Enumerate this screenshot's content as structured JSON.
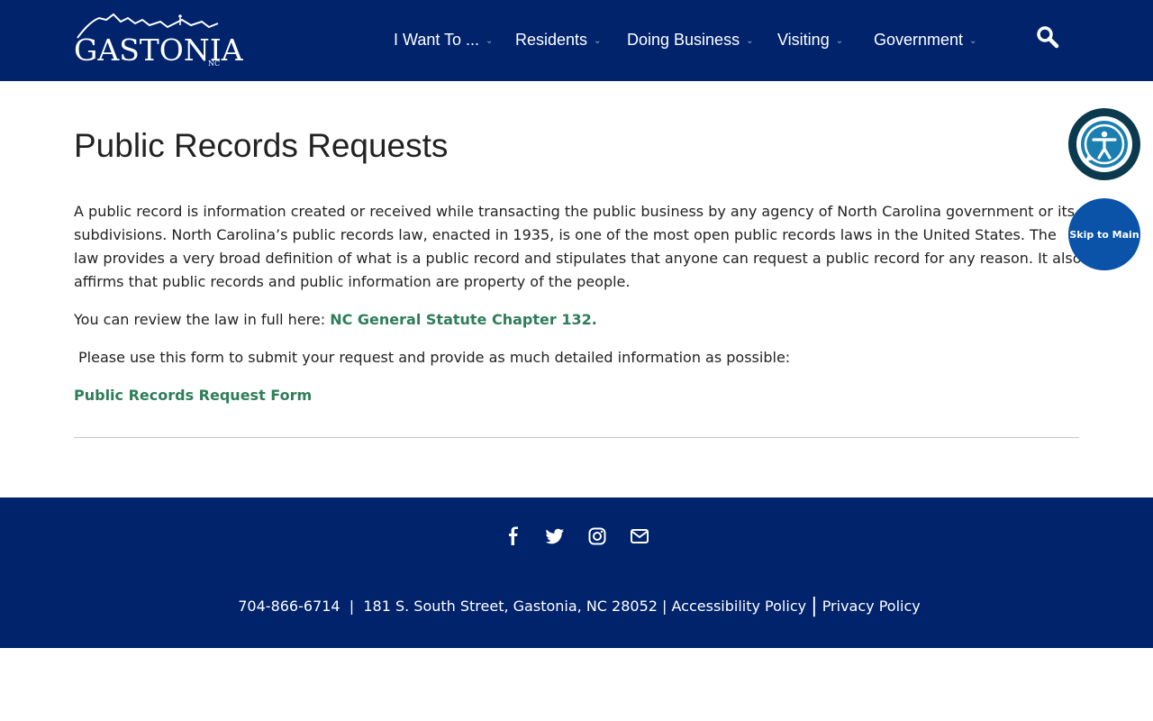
{
  "header": {
    "logo_text": "GASTONIA",
    "logo_sub": "NC",
    "nav": [
      {
        "label": "I Want To ..."
      },
      {
        "label": "Residents"
      },
      {
        "label": "Doing Business"
      },
      {
        "label": "Visiting"
      },
      {
        "label": "Government"
      }
    ],
    "search_icon": "search-icon"
  },
  "main": {
    "title": "Public Records Requests",
    "intro": "A public record is information created or received while transacting the public business by any agency of North Carolina government or its subdivisions.  North Carolina’s public records law, enacted in 1935, is one of the most open public records laws in the United States. The law provides a very broad definition of what is a public record and stipulates that anyone can request a public record for any reason. It also affirms that public records and public information are property of the people.",
    "law_prefix": "You can review the law in full here: ",
    "law_link": "NC General Statute Chapter 132.",
    "form_instruction": "Please use this form to submit your request and provide as much detailed information as possible:",
    "form_link": "Public Records Request Form"
  },
  "footer": {
    "social": [
      "facebook-icon",
      "twitter-icon",
      "instagram-icon",
      "email-icon"
    ],
    "phone": "704-866-6714",
    "address": "181 S. South Street, Gastonia, NC 28052",
    "accessibility_link": "Accessibility Policy",
    "privacy_link": "Privacy Policy"
  },
  "widgets": {
    "accessibility_icon": "accessibility-icon",
    "skip_label": "Skip to Main"
  },
  "colors": {
    "header_bg": "#00236b",
    "link_green": "#2e7d5a",
    "skip_bg": "#0a53a8"
  }
}
